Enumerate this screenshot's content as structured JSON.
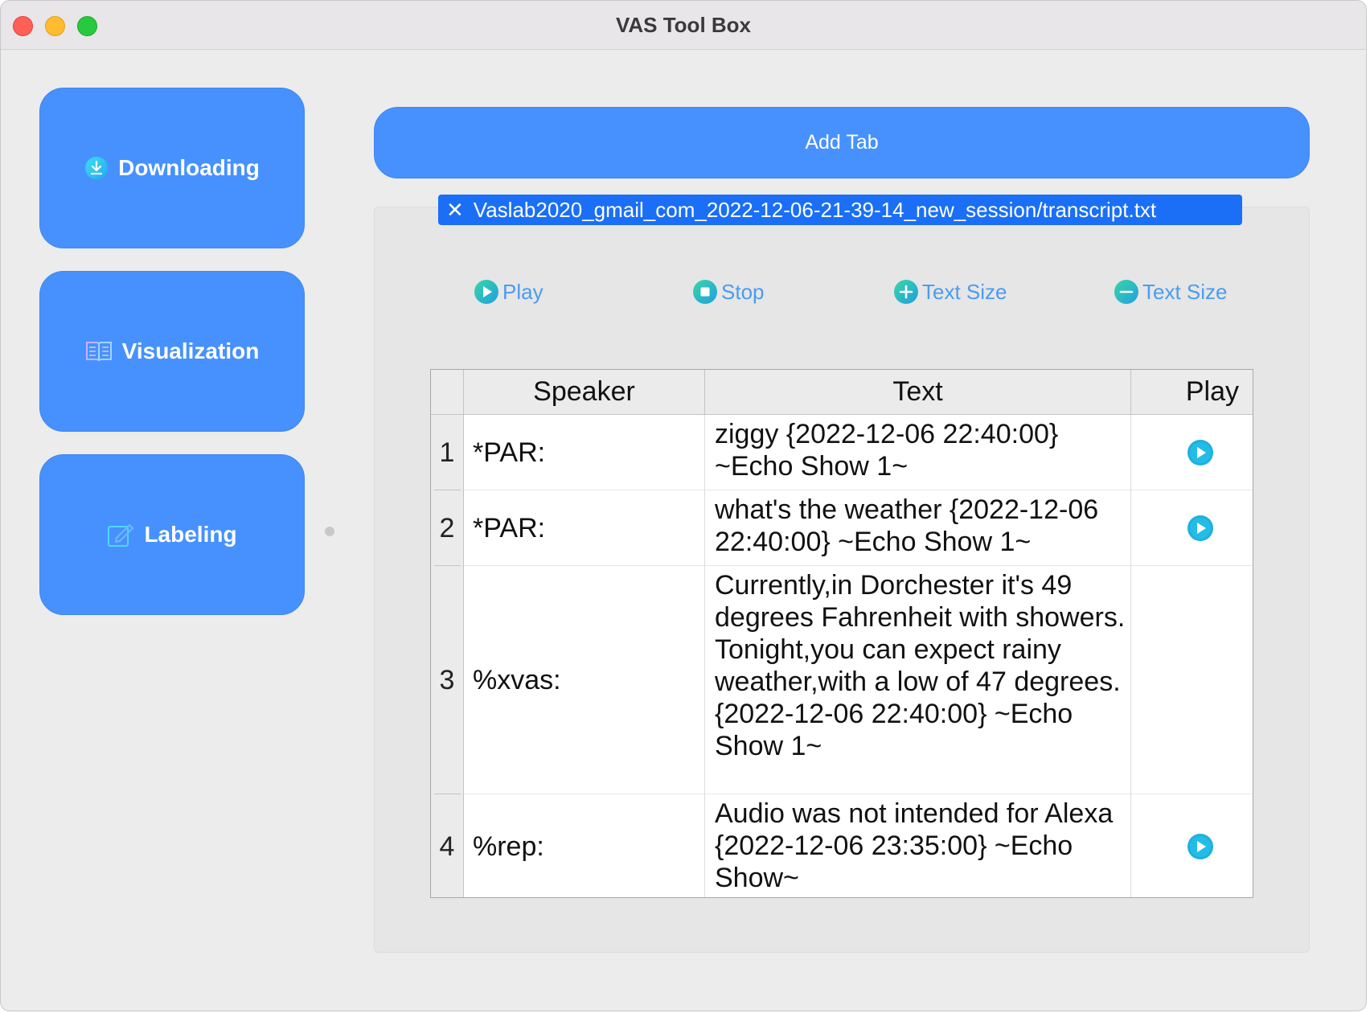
{
  "window": {
    "title": "VAS Tool Box"
  },
  "sidebar": {
    "items": [
      {
        "label": "Downloading",
        "icon": "download-icon"
      },
      {
        "label": "Visualization",
        "icon": "book-icon"
      },
      {
        "label": "Labeling",
        "icon": "edit-icon"
      }
    ]
  },
  "main": {
    "add_tab_label": "Add Tab",
    "tab": {
      "label": "Vaslab2020_gmail_com_2022-12-06-21-39-14_new_session/transcript.txt",
      "close": "✕"
    },
    "toolbar": {
      "play": "Play",
      "stop": "Stop",
      "text_size_increase": "Text Size",
      "text_size_decrease": "Text Size"
    },
    "table": {
      "columns": [
        "Speaker",
        "Text",
        "Play"
      ],
      "rows": [
        {
          "num": "1",
          "speaker": "*PAR:",
          "text": "ziggy {2022-12-06 22:40:00} ~Echo Show 1~",
          "has_play": true
        },
        {
          "num": "2",
          "speaker": "*PAR:",
          "text": "what's the weather {2022-12-06 22:40:00} ~Echo Show 1~",
          "has_play": true
        },
        {
          "num": "3",
          "speaker": "%xvas:",
          "text": "Currently,in Dorchester it's 49 degrees Fahrenheit with showers. Tonight,you can expect rainy weather,with a low of 47 degrees. {2022-12-06 22:40:00} ~Echo Show 1~",
          "has_play": false
        },
        {
          "num": "4",
          "speaker": "%rep:",
          "text": "Audio was not intended for Alexa {2022-12-06 23:35:00} ~Echo Show~",
          "has_play": true
        }
      ]
    }
  },
  "colors": {
    "accent": "#4791ff",
    "tab_active": "#1a6ff6",
    "toolbar_text": "#4a9cf0",
    "play_icon": "#1fb0dd"
  }
}
